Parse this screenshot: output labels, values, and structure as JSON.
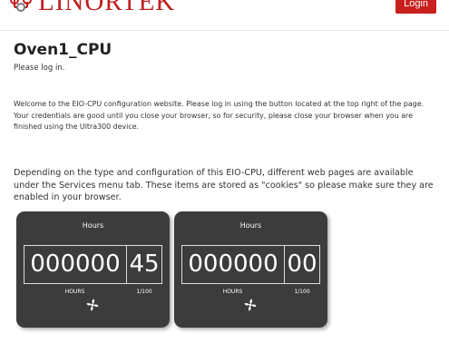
{
  "header": {
    "logo_text": "LINORTEK",
    "login_label": "Login"
  },
  "page": {
    "title": "Oven1_CPU",
    "subtitle": "Please log in.",
    "welcome_text": "Welcome to the EIO-CPU configuration website. Please log in using the button located at the top right of the page. Your credentials are good until you close your browser, so for security, please close your browser when you are finished using the Ultra300 device.",
    "info_text": "Depending on the type and configuration of this EIO-CPU, different web pages are available under the Services menu tab. These items are stored as \"cookies\" so please make sure they are enabled in your browser."
  },
  "counters": [
    {
      "title": "Hours",
      "main_value": "000000",
      "fraction_value": "45",
      "main_label": "HOURS",
      "fraction_label": "1/100",
      "icon": "fan-icon"
    },
    {
      "title": "Hours",
      "main_value": "000000",
      "fraction_value": "00",
      "main_label": "HOURS",
      "fraction_label": "1/100",
      "icon": "fan-icon"
    }
  ],
  "colors": {
    "brand": "#c0201f",
    "login_button": "#c9201d",
    "counter_background": "#3c3c3c"
  }
}
